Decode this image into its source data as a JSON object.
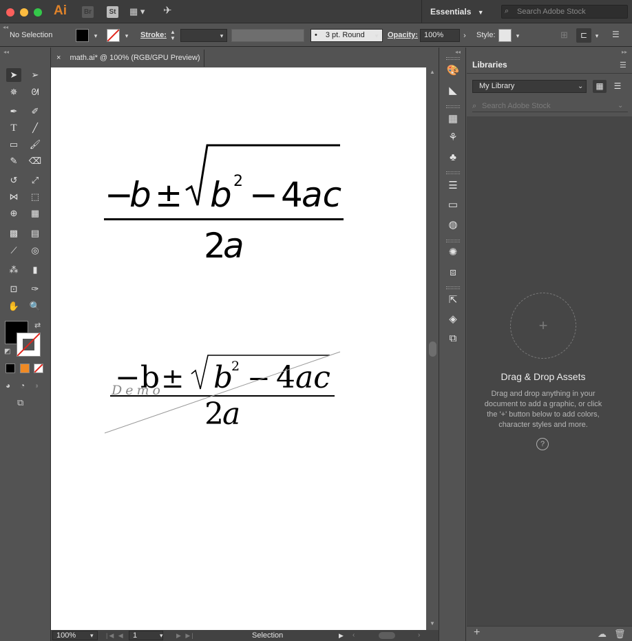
{
  "app": {
    "logo": "Ai",
    "bridge": "Br",
    "stock": "St",
    "workspace": "Essentials",
    "stock_search_placeholder": "Search Adobe Stock",
    "layout_icon": "layout-grid-icon",
    "send_icon": "rocket-icon"
  },
  "control_bar": {
    "selection": "No Selection",
    "stroke_label": "Stroke:",
    "brush": "3 pt. Round",
    "opacity_label": "Opacity:",
    "opacity_value": "100%",
    "style_label": "Style:"
  },
  "document": {
    "tab_title": "math.ai* @ 100% (RGB/GPU Preview)",
    "close": "×",
    "formula_top_num": "−b ± √(b² − 4ac)",
    "formula_top_den": "2a",
    "formula_bottom_num": "−b ± √(b² − 4ac)",
    "formula_bottom_den": "2a",
    "watermark": "Demo"
  },
  "status_bar": {
    "zoom": "100%",
    "page": "1",
    "tool": "Selection"
  },
  "libraries": {
    "tab": "Libraries",
    "library": "My Library",
    "search_placeholder": "Search Adobe Stock",
    "drop_title": "Drag & Drop Assets",
    "drop_desc": "Drag and drop anything in your document to add a graphic, or click the '+' button below to add colors, character styles and more.",
    "help": "?",
    "add": "+",
    "plus_circle": "+"
  },
  "colors": {
    "chrome": "#535353",
    "titlebar": "#3c3c3c",
    "accent_ai": "#e0832a",
    "artboard": "#ffffff"
  }
}
